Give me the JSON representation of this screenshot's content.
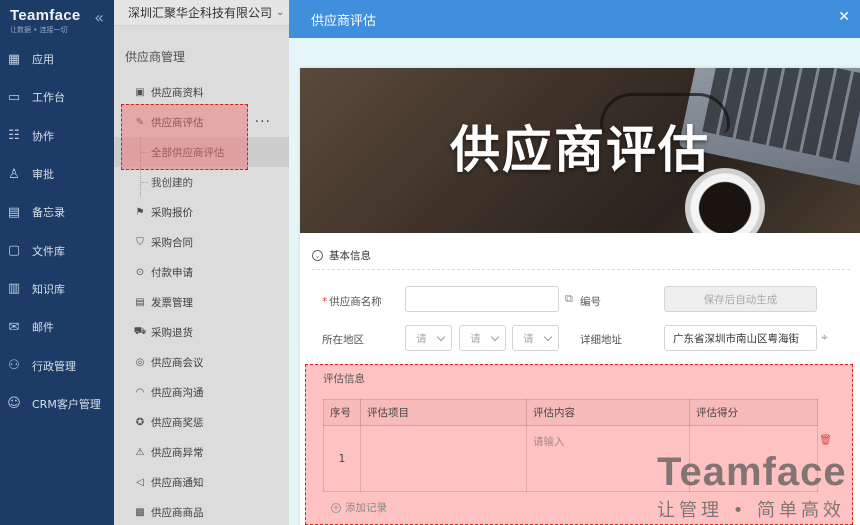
{
  "nav": {
    "brand": "Teamface",
    "slogan": "让数据 • 连接一切",
    "items": [
      {
        "label": "应用",
        "icon": "grid-icon"
      },
      {
        "label": "工作台",
        "icon": "monitor-icon"
      },
      {
        "label": "协作",
        "icon": "team-icon"
      },
      {
        "label": "审批",
        "icon": "stamp-icon"
      },
      {
        "label": "备忘录",
        "icon": "memo-icon"
      },
      {
        "label": "文件库",
        "icon": "folder-icon"
      },
      {
        "label": "知识库",
        "icon": "book-icon"
      },
      {
        "label": "邮件",
        "icon": "mail-icon"
      },
      {
        "label": "行政管理",
        "icon": "admin-icon"
      },
      {
        "label": "CRM客户管理",
        "icon": "crm-icon"
      }
    ]
  },
  "sub": {
    "company": "深圳汇聚华企科技有限公司",
    "section": "供应商管理",
    "items": [
      {
        "label": "供应商资料",
        "icon": "id-card-icon",
        "child": false
      },
      {
        "label": "供应商评估",
        "icon": "edit-icon",
        "child": false
      },
      {
        "label": "全部供应商评估",
        "child": true
      },
      {
        "label": "我创建的",
        "child": true
      },
      {
        "label": "采购报价",
        "icon": "price-icon",
        "child": false
      },
      {
        "label": "采购合同",
        "icon": "shield-icon",
        "child": false
      },
      {
        "label": "付款申请",
        "icon": "payment-icon",
        "child": false
      },
      {
        "label": "发票管理",
        "icon": "invoice-icon",
        "child": false
      },
      {
        "label": "采购退货",
        "icon": "cart-icon",
        "child": false
      },
      {
        "label": "供应商会议",
        "icon": "meeting-icon",
        "child": false
      },
      {
        "label": "供应商沟通",
        "icon": "headset-icon",
        "child": false
      },
      {
        "label": "供应商奖惩",
        "icon": "award-icon",
        "child": false
      },
      {
        "label": "供应商异常",
        "icon": "warning-icon",
        "child": false
      },
      {
        "label": "供应商通知",
        "icon": "notify-icon",
        "child": false
      },
      {
        "label": "供应商商品",
        "icon": "box-icon",
        "child": false
      }
    ]
  },
  "modal": {
    "title": "供应商评估",
    "banner_title": "供应商评估",
    "section": "基本信息",
    "fields": {
      "supplier_name_label": "供应商名称",
      "supplier_name_value": "",
      "number_label": "编号",
      "number_value": "保存后自动生成",
      "region_label": "所在地区",
      "region_selects": [
        "请",
        "请",
        "请"
      ],
      "address_label": "详细地址",
      "address_value": "广东省深圳市南山区粤海街"
    },
    "eval": {
      "title": "评估信息",
      "headers": [
        "序号",
        "评估项目",
        "评估内容",
        "评估得分"
      ],
      "row": {
        "index": "1",
        "item": "",
        "content_placeholder": "请输入",
        "score": ""
      },
      "add_label": "添加记录"
    }
  },
  "watermark": {
    "brand": "Teamface",
    "slogan": "让管理 • 简单高效"
  }
}
